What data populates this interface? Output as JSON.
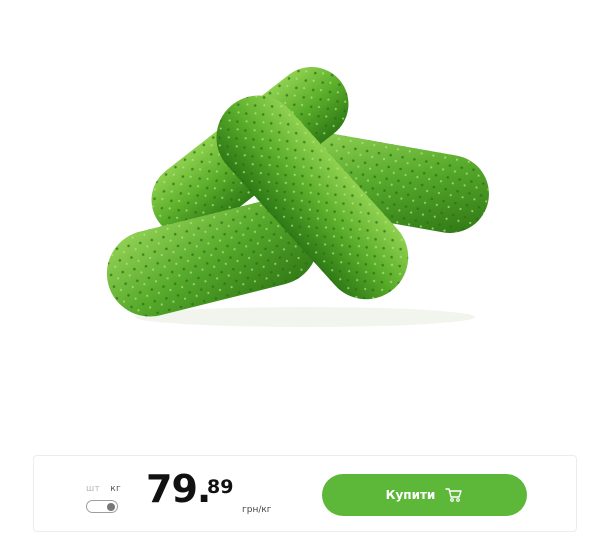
{
  "product": {
    "image_name": "cucumbers-image"
  },
  "buy_panel": {
    "unit_piece_label": "шт",
    "unit_kg_label": "кг",
    "unit_toggle_selected": "кг",
    "price_integer": "79.",
    "price_fraction": "89",
    "price_unit": "грн/кг",
    "buy_label": "Купити",
    "cart_icon": "shopping-cart-icon"
  },
  "colors": {
    "accent": "#5db83a",
    "cucumber_dark": "#3c8a1f",
    "cucumber_light": "#8fd14f"
  }
}
